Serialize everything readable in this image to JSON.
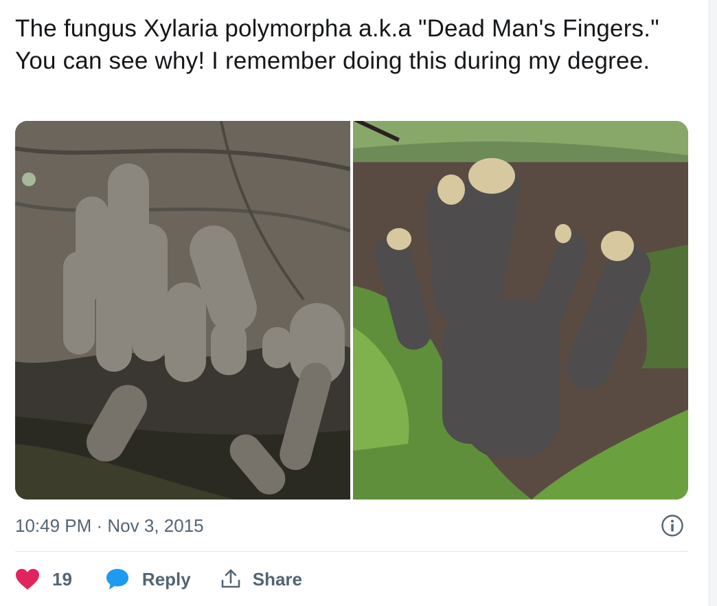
{
  "tweet": {
    "text": "The fungus Xylaria polymorpha a.k.a \"Dead Man's Fingers.\" You can see why! I remember doing this during my degree.",
    "time": "10:49 PM",
    "separator": " · ",
    "date": "Nov 3, 2015"
  },
  "actions": {
    "like_count": "19",
    "reply_label": "Reply",
    "share_label": "Share"
  },
  "icons": {
    "like": "heart-icon",
    "reply": "speech-bubble-icon",
    "share": "share-icon",
    "info": "info-icon"
  },
  "colors": {
    "like": "#e0245e",
    "reply": "#1d9bf0",
    "meta_text": "#536471"
  }
}
